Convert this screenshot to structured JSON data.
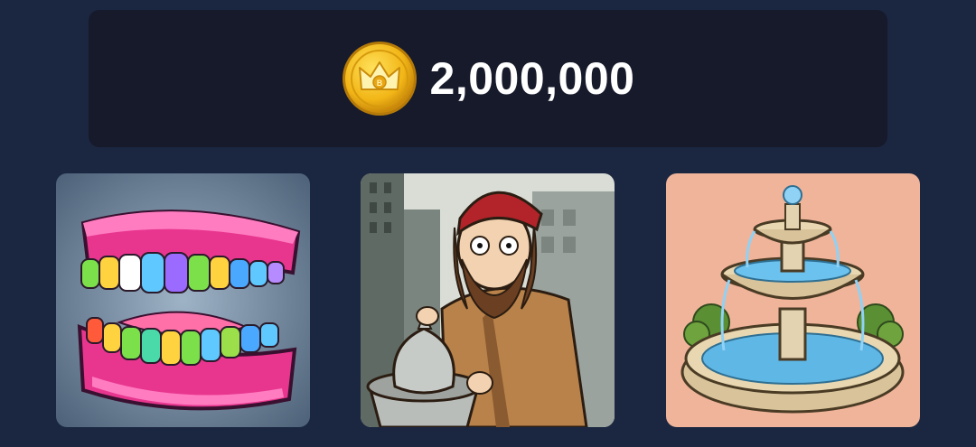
{
  "balance": {
    "amount": "2,000,000",
    "currency_icon": "crown-coin-icon"
  },
  "items": [
    {
      "name": "rainbow-teeth",
      "icon": "teeth-icon"
    },
    {
      "name": "homeless-man",
      "icon": "homeless-man-icon"
    },
    {
      "name": "fountain",
      "icon": "fountain-icon"
    }
  ],
  "colors": {
    "background": "#1b2740",
    "panel": "#161a2b",
    "text": "#ffffff",
    "coin": "#f2b617"
  }
}
